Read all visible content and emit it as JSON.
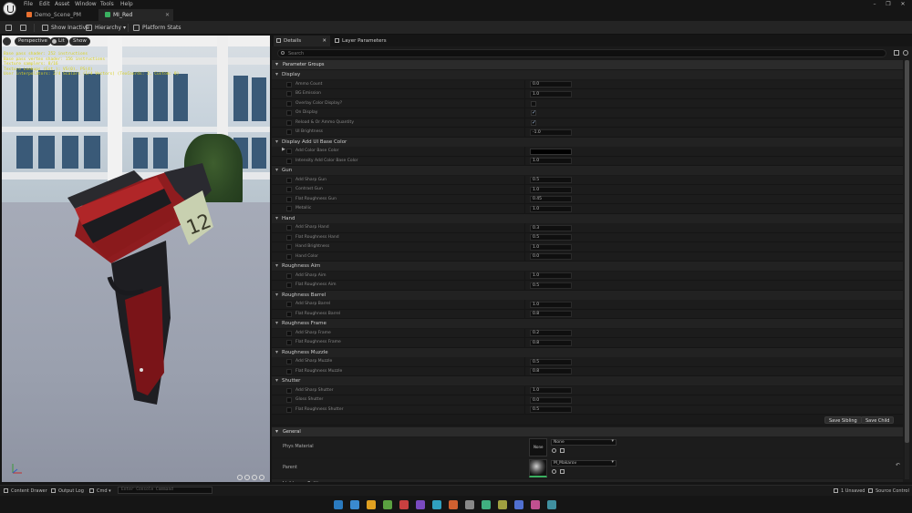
{
  "menu": [
    "File",
    "Edit",
    "Asset",
    "Window",
    "Tools",
    "Help"
  ],
  "window_controls": [
    "–",
    "❐",
    "✕"
  ],
  "tabs": [
    {
      "label": "Demo_Scene_PM",
      "color": "#e87030",
      "close": ""
    },
    {
      "label": "MI_Red",
      "color": "#3ab060",
      "close": "✕"
    }
  ],
  "toolbar": {
    "show_inactive": "Show Inactive",
    "hierarchy": "Hierarchy",
    "platform_stats": "Platform Stats"
  },
  "viewport": {
    "perspective": "Perspective",
    "lit": "Lit",
    "show": "Show",
    "stats": [
      "Base pass shader: 252 instructions",
      "Base pass vertex shader: 156 instructions",
      "Texture samplers: 8/16",
      "Texture Lookups (Est.): VS(0), PS(4)",
      "User interpolators: 2/4 Scalars (1/4 Vectors) (TexCoords: 2, Custom: 0)"
    ]
  },
  "details": {
    "tab_details": "Details",
    "tab_layer": "Layer Parameters",
    "search_placeholder": "Search",
    "parameter_groups": "Parameter Groups",
    "groups": [
      {
        "name": "Display",
        "rows": [
          {
            "label": "Ammo Count",
            "type": "num",
            "value": "0.0"
          },
          {
            "label": "BG Emission",
            "type": "num",
            "value": "1.0"
          },
          {
            "label": "Overlay Color Display?",
            "type": "check",
            "value": false
          },
          {
            "label": "On Display",
            "type": "check",
            "value": true
          },
          {
            "label": "Reload & Or Ammo Quantity",
            "type": "check",
            "value": true
          },
          {
            "label": "UI Brightness",
            "type": "num",
            "value": "-1.0"
          }
        ]
      },
      {
        "name": "Display Add UI Base Color",
        "rows": [
          {
            "label": "Add Color Base Color",
            "type": "color",
            "value": "#000000"
          },
          {
            "label": "Intensity Add Color Base Color",
            "type": "num",
            "value": "1.0"
          }
        ]
      },
      {
        "name": "Gun",
        "rows": [
          {
            "label": "Add Sharp Gun",
            "type": "num",
            "value": "0.5"
          },
          {
            "label": "Contrast Gun",
            "type": "num",
            "value": "1.0"
          },
          {
            "label": "Flat Roughness Gun",
            "type": "num",
            "value": "0.45"
          },
          {
            "label": "Metallic",
            "type": "num",
            "value": "1.0"
          }
        ]
      },
      {
        "name": "Hand",
        "rows": [
          {
            "label": "Add Sharp Hand",
            "type": "num",
            "value": "0.3"
          },
          {
            "label": "Flat Roughness Hand",
            "type": "num",
            "value": "0.5"
          },
          {
            "label": "Hand Brightness",
            "type": "num",
            "value": "1.0"
          },
          {
            "label": "Hand Color",
            "type": "num",
            "value": "0.0"
          }
        ]
      },
      {
        "name": "Roughness Aim",
        "rows": [
          {
            "label": "Add Sharp Aim",
            "type": "num",
            "value": "1.0"
          },
          {
            "label": "Flat Roughness Aim",
            "type": "num",
            "value": "0.5"
          }
        ]
      },
      {
        "name": "Roughness Barrel",
        "rows": [
          {
            "label": "Add Sharp Barrel",
            "type": "num",
            "value": "1.0"
          },
          {
            "label": "Flat Roughness Barrel",
            "type": "num",
            "value": "0.8"
          }
        ]
      },
      {
        "name": "Roughness Frame",
        "rows": [
          {
            "label": "Add Sharp Frame",
            "type": "num",
            "value": "0.2"
          },
          {
            "label": "Flat Roughness Frame",
            "type": "num",
            "value": "0.8"
          }
        ]
      },
      {
        "name": "Roughness Muzzle",
        "rows": [
          {
            "label": "Add Sharp Muzzle",
            "type": "num",
            "value": "0.5"
          },
          {
            "label": "Flat Roughness Muzzle",
            "type": "num",
            "value": "0.8"
          }
        ]
      },
      {
        "name": "Shutter",
        "rows": [
          {
            "label": "Add Sharp Shutter",
            "type": "num",
            "value": "1.0"
          },
          {
            "label": "Gloss Shutter",
            "type": "num",
            "value": "0.0"
          },
          {
            "label": "Flat Roughness Shutter",
            "type": "num",
            "value": "0.5"
          }
        ]
      }
    ],
    "save_sibling": "Save Sibling",
    "save_child": "Save Child",
    "general": "General",
    "phys_material_label": "Phys Material",
    "phys_material_value": "None",
    "phys_thumb_text": "None",
    "parent_label": "Parent",
    "parent_value": "M_Makarov",
    "lightmass": "Lightmass Settings"
  },
  "statusbar": {
    "content_drawer": "Content Drawer",
    "output_log": "Output Log",
    "cmd": "Cmd",
    "console_placeholder": "Enter Console Command",
    "unsaved": "1 Unsaved",
    "source_control": "Source Control"
  },
  "taskbar_colors": [
    "#2a7abf",
    "#3a8ad0",
    "#e0a020",
    "#5aa040",
    "#c84040",
    "#7a4ac0",
    "#30a0c0",
    "#d06030",
    "#888888",
    "#40b080",
    "#a0a040",
    "#5070d0",
    "#c05090",
    "#4090a0"
  ]
}
